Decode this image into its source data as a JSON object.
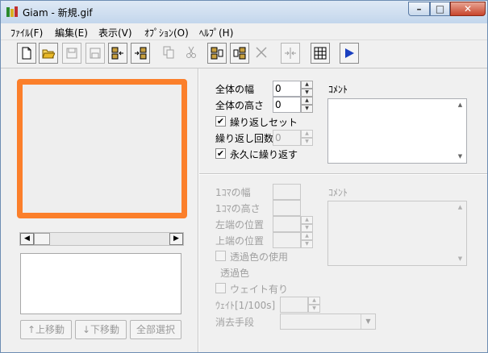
{
  "window": {
    "title": "Giam - 新規.gif",
    "min_glyph": "–",
    "max_glyph": "□",
    "close_glyph": "✕"
  },
  "menu": [
    "ﾌｧｲﾙ(F)",
    "編集(E)",
    "表示(V)",
    "ｵﾌﾟｼｮﾝ(O)",
    "ﾍﾙﾌﾟ(H)"
  ],
  "toolbar": {
    "buttons": [
      "new-icon",
      "open-icon",
      "save-icon",
      "save-as-icon",
      "insert-frame-before-icon",
      "insert-frame-after-icon",
      "copy-icon",
      "cut-icon",
      "paste-before-icon",
      "paste-after-icon",
      "delete-icon",
      "split-icon",
      "grid-icon",
      "play-icon"
    ]
  },
  "frame_list": {
    "move_up": "↑上移動",
    "move_down": "↓下移動",
    "select_all": "全部選択"
  },
  "global": {
    "width_label": "全体の幅",
    "width_value": "0",
    "height_label": "全体の高さ",
    "height_value": "0",
    "loop_set_label": "繰り返しセット",
    "loop_set_checked": true,
    "loop_count_label": "繰り返し回数",
    "loop_count_value": "0",
    "loop_forever_label": "永久に繰り返す",
    "loop_forever_checked": true,
    "comment_label": "ｺﾒﾝﾄ"
  },
  "frame": {
    "width_label": "1ｺﾏの幅",
    "height_label": "1ｺﾏの高さ",
    "left_label": "左端の位置",
    "top_label": "上端の位置",
    "transparent_use_label": "透過色の使用",
    "transparent_color_label": "透過色",
    "wait_label": "ウェイト有り",
    "wait_time_label": "ｳｪｲﾄ[1/100s]",
    "dispose_label": "消去手段",
    "comment_label": "ｺﾒﾝﾄ"
  },
  "colors": {
    "preview_border": "#fb7f2b",
    "play": "#1a3fc0"
  }
}
